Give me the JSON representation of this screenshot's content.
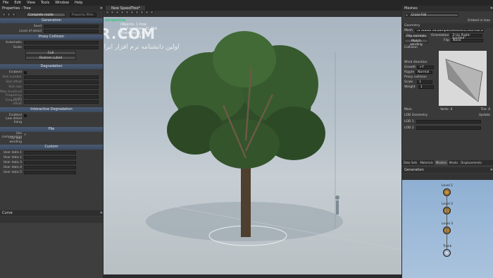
{
  "menu": [
    "File",
    "Edit",
    "View",
    "Tools",
    "Window",
    "Help"
  ],
  "left": {
    "title": "Properties - Tree",
    "mode": "Complete mode",
    "search": "Property filter",
    "generation": "Generation",
    "seed": "Seed",
    "level_of_detail": "Level of detail",
    "proxy_collision": "Proxy Collision",
    "automatic": "Automatic",
    "scale": "Scale",
    "cull": "Cull",
    "restore": "Restore culled",
    "degradation": "Degradation",
    "enabled": "Enabled",
    "slots": [
      "Slot number",
      "Slot offset",
      "Slot size",
      "Max level/cull",
      "Frequency scale",
      "Frequency offset"
    ],
    "interactive_degradation": "Interactive Degradation",
    "enabled2": "Enabled",
    "low_detail": "Low detail hang",
    "file": "File",
    "use_compression": "Use compression",
    "fix_leaf": "Fix leaf winding",
    "custom": "Custom",
    "user_data": [
      "User data 1",
      "User data 2",
      "User data 3",
      "User data 4",
      "User data 5"
    ],
    "curve": "Curve"
  },
  "viewport": {
    "tab": "New SpeedTree*",
    "label": "perspective",
    "watermark": "SOFTGOZAR.COM",
    "watermark_fa": "اولین دانشنامه نرم افزار ایران",
    "stats": [
      "Objects: 1 tree",
      "Leaf meshes: 21,456",
      "Triangles: 1,0 ms",
      "Fps: 60 / 14.3"
    ]
  },
  "right": {
    "title": "Meshes",
    "mesh_name": "Cross-Fall",
    "embed": "Embed in tree",
    "geometry": "Geometry",
    "mesh_label": "Mesh",
    "mesh_path": "ra Studio v8\\Samples\\Meshes\\Cross-Fall.stm",
    "flip_normals": "Flip normals",
    "orientation": "Orientation",
    "orientation_val": "Z-Up Right-handed",
    "match_winding": "Match winding",
    "flip": "Flip",
    "flip_val": "None",
    "collision": "Collision",
    "wind_direction": "Wind direction",
    "growth": "Growth",
    "growth_val": "+Y",
    "ripple": "Ripple",
    "ripple_val": "Normal",
    "proxy_collision": "Proxy collision",
    "scale": "Scale",
    "scale_val": "1",
    "weight": "Weight",
    "weight_val": "1",
    "main": "Main",
    "verts": "Verts: 4",
    "tris": "Tris: 4",
    "lod_geometry": "LOD Geometry",
    "update": "Update",
    "lod1": "LOD 1",
    "lod2": "LOD 2",
    "tabs": [
      "Data Sets",
      "Materials",
      "Meshes",
      "Masks",
      "Displacements"
    ],
    "generation": "Generation",
    "nodes": [
      "Level 1",
      "Level 2",
      "Level 3",
      "Trunk"
    ]
  },
  "colors": {
    "accent": "#4a5a72",
    "tab_active": "#2f2f2f"
  }
}
